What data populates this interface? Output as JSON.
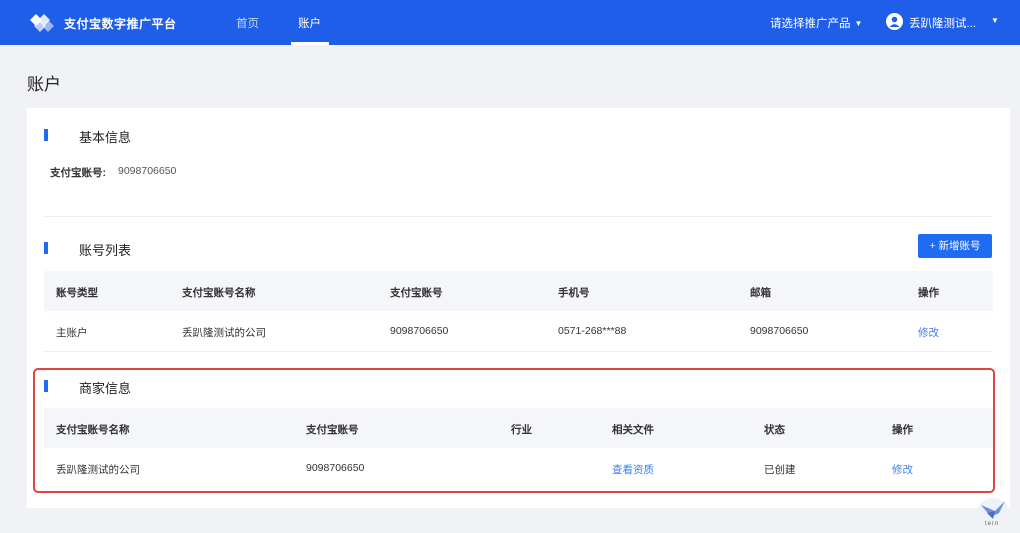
{
  "header": {
    "brand": "支付宝数字推广平台",
    "nav": [
      {
        "label": "首页"
      },
      {
        "label": "账户"
      }
    ],
    "product_select": "请选择推广产品",
    "user_name": "丢趴隆测试..."
  },
  "page_title": "账户",
  "basic_info": {
    "title": "基本信息",
    "account_label": "支付宝账号:",
    "account_value": "9098706650"
  },
  "account_list": {
    "title": "账号列表",
    "add_button": "+ 新增账号",
    "columns": [
      "账号类型",
      "支付宝账号名称",
      "支付宝账号",
      "手机号",
      "邮箱",
      "操作"
    ],
    "rows": [
      [
        "主账户",
        "丢趴隆测试的公司",
        "9098706650",
        "0571-268***88",
        "9098706650",
        "修改"
      ]
    ]
  },
  "merchant_info": {
    "title": "商家信息",
    "columns": [
      "支付宝账号名称",
      "支付宝账号",
      "行业",
      "相关文件",
      "状态",
      "操作"
    ],
    "rows": [
      [
        "丢趴隆测试的公司",
        "9098706650",
        "",
        "查看资质",
        "已创建",
        "修改"
      ]
    ]
  },
  "watermark": "tern",
  "colors": {
    "primary": "#1f5ee8",
    "accent": "#1f6bf2",
    "link": "#3c7ef3",
    "highlight": "#e0453b"
  }
}
